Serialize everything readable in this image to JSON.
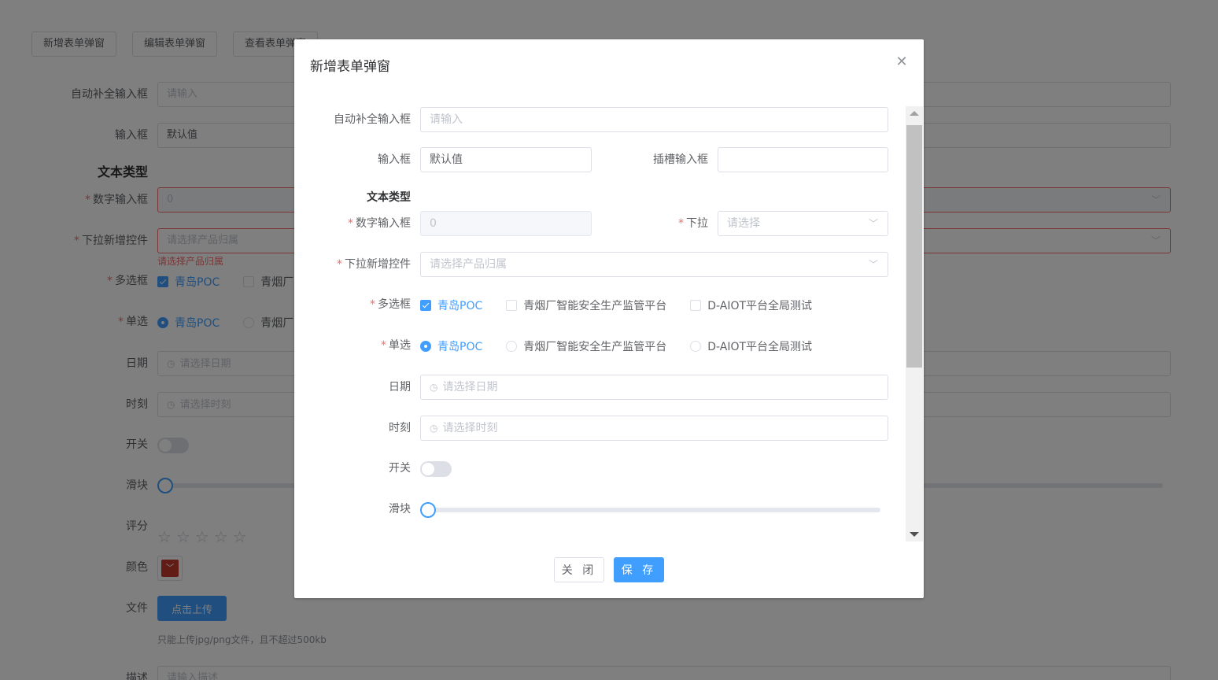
{
  "top_buttons": [
    "新增表单弹窗",
    "编辑表单弹窗",
    "查看表单弹窗"
  ],
  "background": {
    "autocomplete": {
      "label": "自动补全输入框",
      "placeholder": "请输入"
    },
    "input": {
      "label": "输入框",
      "value": "默认值"
    },
    "section_title": "文本类型",
    "number": {
      "label": "数字输入框",
      "value": "0"
    },
    "dropdown_add": {
      "label": "下拉新增控件",
      "placeholder": "请选择产品归属",
      "error": "请选择产品归属"
    },
    "checkbox": {
      "label": "多选框",
      "options": [
        "青岛POC",
        "青烟厂"
      ]
    },
    "radio": {
      "label": "单选",
      "options": [
        "青岛POC",
        "青烟厂"
      ]
    },
    "date": {
      "label": "日期",
      "placeholder": "请选择日期"
    },
    "time": {
      "label": "时刻",
      "placeholder": "请选择时刻"
    },
    "switch": {
      "label": "开关"
    },
    "slider": {
      "label": "滑块",
      "value": 0
    },
    "rate": {
      "label": "评分",
      "value": 0,
      "max": 5
    },
    "color": {
      "label": "颜色",
      "value": "#c0392b"
    },
    "file": {
      "label": "文件",
      "button": "点击上传",
      "tip": "只能上传jpg/png文件，且不超过500kb"
    },
    "description": {
      "label": "描述",
      "placeholder": "请输入描述"
    }
  },
  "dialog": {
    "title": "新增表单弹窗",
    "close_icon": "close-icon",
    "form": {
      "autocomplete": {
        "label": "自动补全输入框",
        "placeholder": "请输入"
      },
      "input": {
        "label": "输入框",
        "value": "默认值"
      },
      "slot_input": {
        "label": "插槽输入框",
        "value": ""
      },
      "section_title": "文本类型",
      "number": {
        "label": "数字输入框",
        "value": "0",
        "required": true
      },
      "select": {
        "label": "下拉",
        "placeholder": "请选择",
        "required": true
      },
      "dropdown_add": {
        "label": "下拉新增控件",
        "placeholder": "请选择产品归属",
        "required": true
      },
      "checkbox": {
        "label": "多选框",
        "required": true,
        "options": [
          {
            "label": "青岛POC",
            "checked": true
          },
          {
            "label": "青烟厂智能安全生产监管平台",
            "checked": false
          },
          {
            "label": "D-AIOT平台全局测试",
            "checked": false
          }
        ]
      },
      "radio": {
        "label": "单选",
        "required": true,
        "options": [
          {
            "label": "青岛POC",
            "checked": true
          },
          {
            "label": "青烟厂智能安全生产监管平台",
            "checked": false
          },
          {
            "label": "D-AIOT平台全局测试",
            "checked": false
          }
        ]
      },
      "date": {
        "label": "日期",
        "placeholder": "请选择日期"
      },
      "time": {
        "label": "时刻",
        "placeholder": "请选择时刻"
      },
      "switch": {
        "label": "开关",
        "on": false
      },
      "slider": {
        "label": "滑块",
        "value": 0
      }
    },
    "footer": {
      "close": "关 闭",
      "save": "保 存"
    }
  },
  "colors": {
    "primary": "#409eff",
    "error": "#f56c6c",
    "overlay": "rgba(0,0,0,0.5)"
  }
}
